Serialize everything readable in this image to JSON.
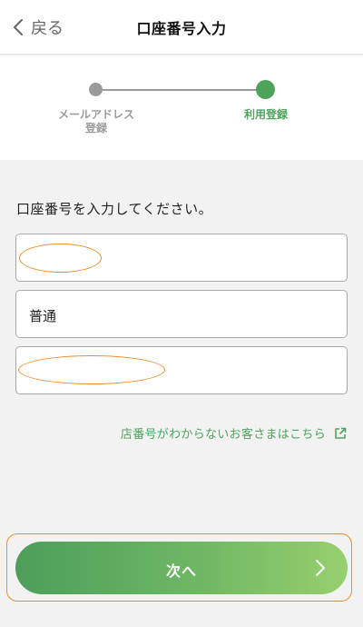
{
  "header": {
    "back_label": "戻る",
    "title": "口座番号入力"
  },
  "stepper": {
    "steps": [
      {
        "label": "メールアドレス\n登録",
        "active": false
      },
      {
        "label": "利用登録",
        "active": true
      }
    ]
  },
  "form": {
    "instruction": "口座番号を入力してください。",
    "fields": [
      {
        "name": "field-1",
        "value": "",
        "redacted": true
      },
      {
        "name": "account-type",
        "value": "普通",
        "redacted": false
      },
      {
        "name": "field-3",
        "value": "",
        "redacted": true
      }
    ],
    "help_link": "店番号がわからないお客さまはこちら"
  },
  "footer": {
    "next_label": "次へ"
  },
  "colors": {
    "accent": "#4ea35c",
    "inactive": "#9a9a9a",
    "highlight": "#f08c2a"
  },
  "icons": {
    "back": "chevron-left-icon",
    "external": "external-link-icon",
    "next": "chevron-right-icon"
  }
}
